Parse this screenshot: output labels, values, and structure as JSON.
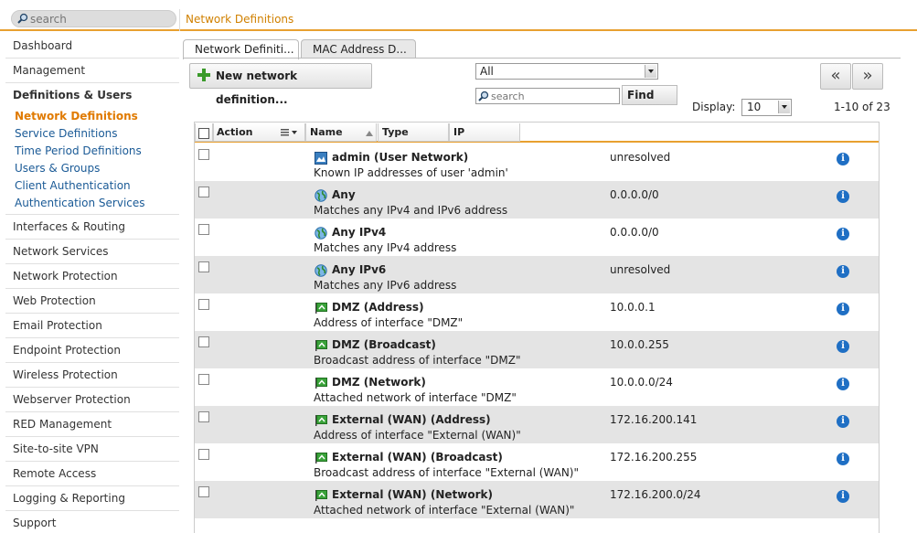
{
  "search": {
    "placeholder": "search"
  },
  "header": {
    "title": "Network Definitions"
  },
  "sidebar": {
    "items_top": [
      "Dashboard",
      "Management"
    ],
    "section": "Definitions & Users",
    "sub_items": [
      "Network Definitions",
      "Service Definitions",
      "Time Period Definitions",
      "Users & Groups",
      "Client Authentication",
      "Authentication Services"
    ],
    "active_sub": "Network Definitions",
    "items_bottom": [
      "Interfaces & Routing",
      "Network Services",
      "Network Protection",
      "Web Protection",
      "Email Protection",
      "Endpoint Protection",
      "Wireless Protection",
      "Webserver Protection",
      "RED Management",
      "Site-to-site VPN",
      "Remote Access",
      "Logging & Reporting",
      "Support"
    ]
  },
  "tabs": [
    "Network Definiti...",
    "MAC Address D..."
  ],
  "toolbar": {
    "new_label": "New network definition...",
    "filter_value": "All",
    "search_placeholder": "search",
    "find_label": "Find",
    "prev_label": "«",
    "next_label": "»",
    "display_label": "Display:",
    "display_value": "10",
    "range": "1-10 of 23"
  },
  "table": {
    "columns": [
      "Action",
      "Name",
      "Type",
      "IP"
    ],
    "rows": [
      {
        "name": "admin (User Network)",
        "desc": "Known IP addresses of user 'admin'",
        "ip": "unresolved",
        "icon": "user-network-icon"
      },
      {
        "name": "Any",
        "desc": "Matches any IPv4 and IPv6 address",
        "ip": "0.0.0.0/0",
        "icon": "globe-icon"
      },
      {
        "name": "Any IPv4",
        "desc": "Matches any IPv4 address",
        "ip": "0.0.0.0/0",
        "icon": "globe-icon"
      },
      {
        "name": "Any IPv6",
        "desc": "Matches any IPv6 address",
        "ip": "unresolved",
        "icon": "globe-icon"
      },
      {
        "name": "DMZ (Address)",
        "desc": "Address of interface \"DMZ\"",
        "ip": "10.0.0.1",
        "icon": "interface-flag-icon"
      },
      {
        "name": "DMZ (Broadcast)",
        "desc": "Broadcast address of interface \"DMZ\"",
        "ip": "10.0.0.255",
        "icon": "interface-flag-icon"
      },
      {
        "name": "DMZ (Network)",
        "desc": "Attached network of interface \"DMZ\"",
        "ip": "10.0.0.0/24",
        "icon": "interface-flag-icon"
      },
      {
        "name": "External (WAN) (Address)",
        "desc": "Address of interface \"External (WAN)\"",
        "ip": "172.16.200.141",
        "icon": "interface-flag-icon"
      },
      {
        "name": "External (WAN) (Broadcast)",
        "desc": "Broadcast address of interface \"External (WAN)\"",
        "ip": "172.16.200.255",
        "icon": "interface-flag-icon"
      },
      {
        "name": "External (WAN) (Network)",
        "desc": "Attached network of interface \"External (WAN)\"",
        "ip": "172.16.200.0/24",
        "icon": "interface-flag-icon"
      }
    ]
  },
  "colors": {
    "accent": "#e8a030",
    "active_nav": "#e07a00",
    "link": "#1a5a96",
    "info": "#1f6fc4"
  }
}
